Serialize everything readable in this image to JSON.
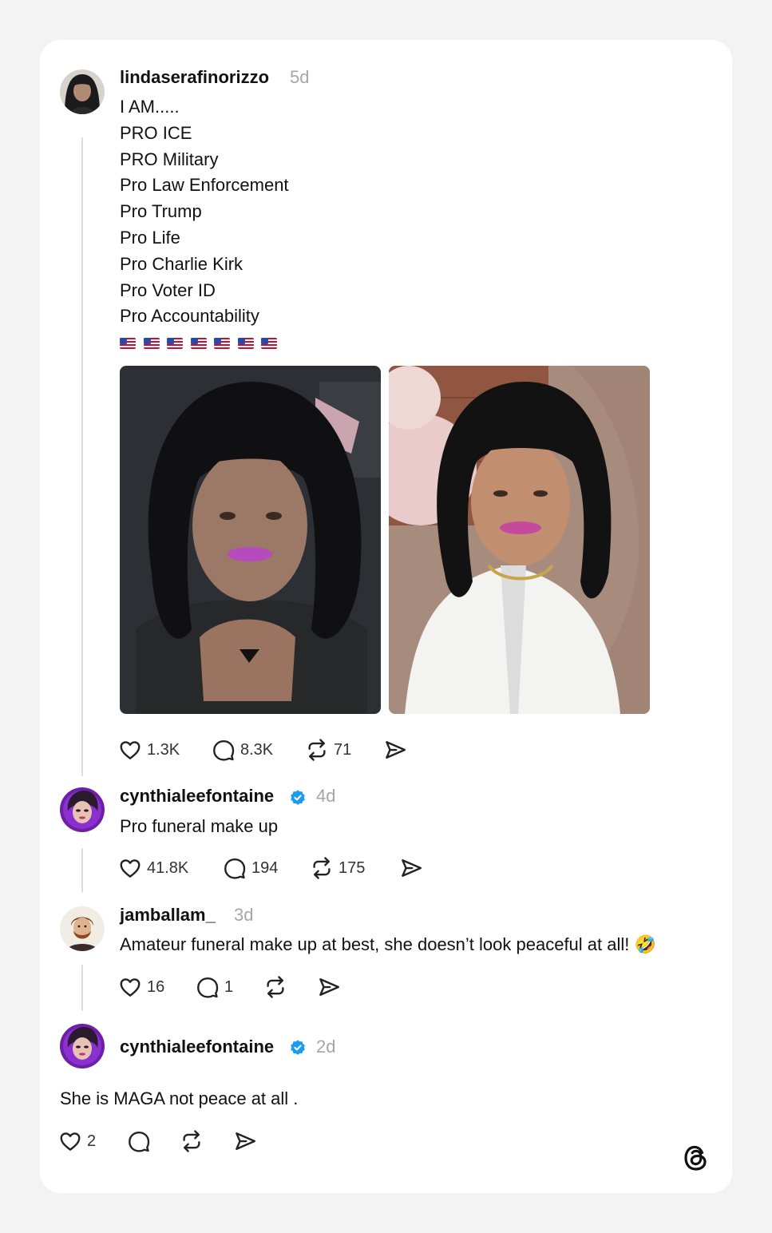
{
  "post": {
    "username": "lindaserafinorizzo",
    "time": "5d",
    "lines": [
      "I AM.....",
      "PRO ICE",
      "PRO Military",
      "Pro Law Enforcement",
      "Pro Trump",
      "Pro Life",
      "Pro Charlie Kirk",
      "Pro Voter ID",
      "Pro Accountability"
    ],
    "emoji_row": [
      "🇺🇸",
      "🇺🇸",
      "🇺🇸",
      "🇺🇸",
      "🇺🇸",
      "🇺🇸",
      "🇺🇸"
    ],
    "likes": "1.3K",
    "replies": "8.3K",
    "reposts": "71"
  },
  "reply1": {
    "username": "cynthialeefontaine",
    "time": "4d",
    "text": "Pro funeral make up",
    "likes": "41.8K",
    "replies": "194",
    "reposts": "175"
  },
  "reply2": {
    "username": "jamballam_",
    "time": "3d",
    "text": "Amateur funeral make up at best, she doesn’t look peaceful at all! 🤣",
    "likes": "16",
    "replies": "1"
  },
  "reply3": {
    "username": "cynthialeefontaine",
    "time": "2d",
    "text": "She is MAGA not peace at all .",
    "likes": "2"
  },
  "colors": {
    "background": "#f3f3f3",
    "card": "#ffffff",
    "verified": "#1d9bf0",
    "muted": "#a6a6a6",
    "thread_line": "#dcdcdc"
  }
}
